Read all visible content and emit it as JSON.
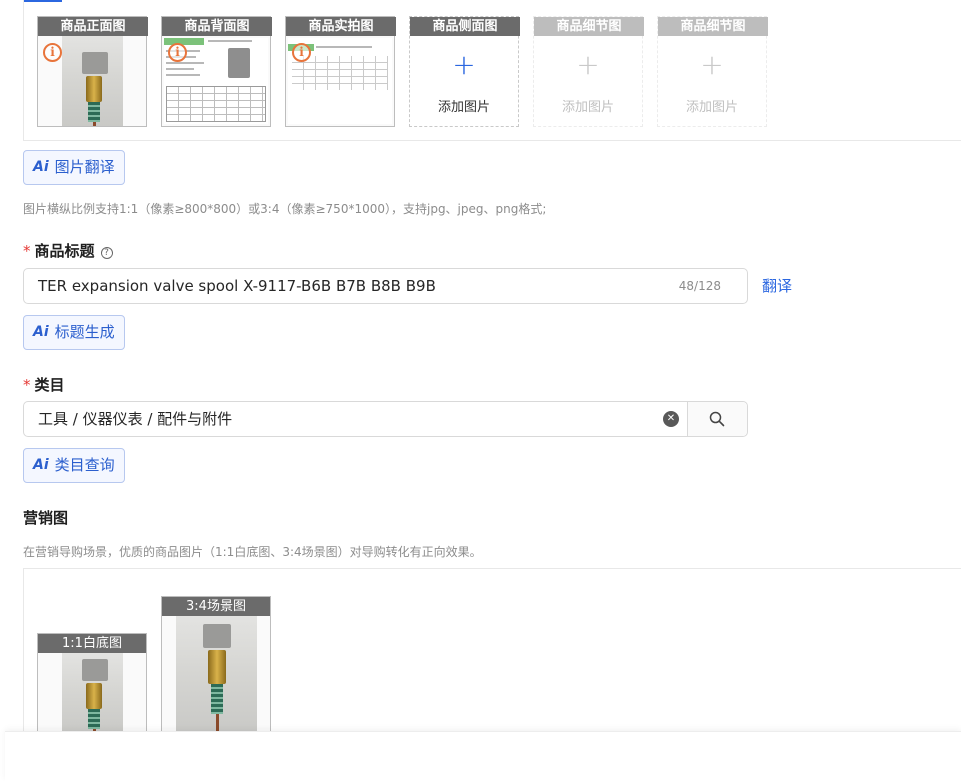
{
  "main_images": {
    "slots": [
      {
        "label": "商品正面图"
      },
      {
        "label": "商品背面图"
      },
      {
        "label": "商品实拍图"
      },
      {
        "label": "商品侧面图",
        "add_text": "添加图片"
      },
      {
        "label": "商品细节图",
        "add_text": "添加图片"
      },
      {
        "label": "商品细节图",
        "add_text": "添加图片"
      }
    ],
    "translate_button": "图片翻译",
    "hint": "图片横纵比例支持1:1（像素≥800*800）或3:4（像素≥750*1000），支持jpg、jpeg、png格式;"
  },
  "title_field": {
    "label": "商品标题",
    "value": "TER expansion valve spool X-9117-B6B B7B B8B B9B",
    "count": "48/128",
    "translate_link": "翻译",
    "generate_button": "标题生成"
  },
  "category_field": {
    "label": "类目",
    "value": "工具 / 仪器仪表 / 配件与附件",
    "query_button": "类目查询"
  },
  "marketing": {
    "label": "营销图",
    "hint": "在营销导购场景，优质的商品图片（1:1白底图、3:4场景图）对导购转化有正向效果。",
    "slots": [
      {
        "label": "1:1白底图"
      },
      {
        "label": "3:4场景图"
      }
    ]
  },
  "colors": {
    "accent": "#2b67e0",
    "required": "#e53935",
    "warning": "#e8743b"
  }
}
